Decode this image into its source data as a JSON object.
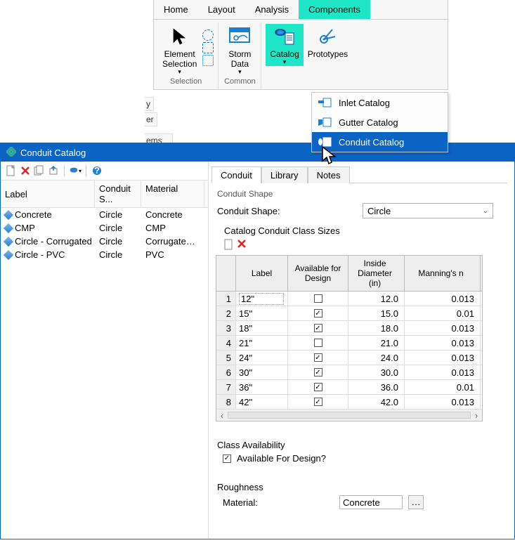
{
  "ribbon": {
    "tabs": [
      "Home",
      "Layout",
      "Analysis",
      "Components"
    ],
    "groups": {
      "selection": {
        "label": "Selection",
        "element_selection": "Element\nSelection"
      },
      "common": {
        "label": "Common",
        "storm_data": "Storm\nData"
      },
      "components": {
        "catalog": "Catalog",
        "prototypes": "Prototypes"
      }
    }
  },
  "catalog_menu": {
    "items": [
      {
        "label": "Inlet Catalog"
      },
      {
        "label": "Gutter Catalog"
      },
      {
        "label": "Conduit Catalog"
      }
    ]
  },
  "stray": {
    "y": "y",
    "er": "er",
    "ems": "ems"
  },
  "window": {
    "title": "Conduit Catalog",
    "list": {
      "headers": {
        "label": "Label",
        "shape": "Conduit S...",
        "material": "Material"
      },
      "rows": [
        {
          "label": "Concrete",
          "shape": "Circle",
          "material": "Concrete"
        },
        {
          "label": "CMP",
          "shape": "Circle",
          "material": "CMP"
        },
        {
          "label": "Circle - Corrugated ...",
          "shape": "Circle",
          "material": "Corrugated H"
        },
        {
          "label": "Circle - PVC",
          "shape": "Circle",
          "material": "PVC"
        }
      ]
    },
    "right": {
      "tabs": [
        "Conduit",
        "Library",
        "Notes"
      ],
      "shape_section": "Conduit Shape",
      "shape_label": "Conduit Shape:",
      "shape_value": "Circle",
      "sizes_title": "Catalog Conduit Class Sizes",
      "grid_headers": {
        "label": "Label",
        "avail": "Available for Design",
        "diam": "Inside Diameter (in)",
        "mann": "Manning's n"
      },
      "class_availability_title": "Class Availability",
      "available_for_design_label": "Available For Design?",
      "available_for_design_checked": true,
      "roughness_title": "Roughness",
      "material_label": "Material:",
      "material_value": "Concrete"
    }
  },
  "chart_data": {
    "type": "table",
    "columns": [
      "Label",
      "Available for Design",
      "Inside Diameter (in)",
      "Manning's n"
    ],
    "rows": [
      {
        "n": 1,
        "label": "12\"",
        "avail": false,
        "diam": 12.0,
        "mann": 0.013
      },
      {
        "n": 2,
        "label": "15\"",
        "avail": true,
        "diam": 15.0,
        "mann": 0.01
      },
      {
        "n": 3,
        "label": "18\"",
        "avail": true,
        "diam": 18.0,
        "mann": 0.013
      },
      {
        "n": 4,
        "label": "21\"",
        "avail": false,
        "diam": 21.0,
        "mann": 0.013
      },
      {
        "n": 5,
        "label": "24\"",
        "avail": true,
        "diam": 24.0,
        "mann": 0.013
      },
      {
        "n": 6,
        "label": "30\"",
        "avail": true,
        "diam": 30.0,
        "mann": 0.013
      },
      {
        "n": 7,
        "label": "36\"",
        "avail": true,
        "diam": 36.0,
        "mann": 0.01
      },
      {
        "n": 8,
        "label": "42\"",
        "avail": true,
        "diam": 42.0,
        "mann": 0.013
      }
    ]
  }
}
